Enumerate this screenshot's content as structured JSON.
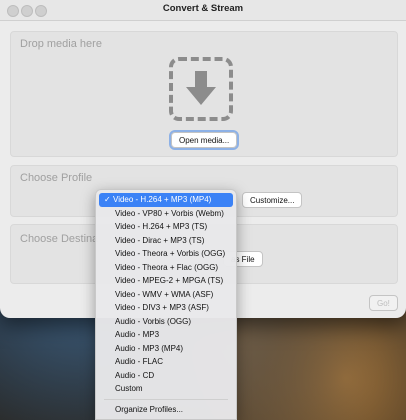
{
  "window": {
    "title": "Convert & Stream"
  },
  "drop": {
    "label": "Drop media here",
    "open_button": "Open media..."
  },
  "profile": {
    "label": "Choose Profile",
    "customize_button": "Customize...",
    "menu": {
      "selected_check": "✓",
      "items": [
        "Video - H.264 + MP3 (MP4)",
        "Video - VP80 + Vorbis (Webm)",
        "Video - H.264 + MP3 (TS)",
        "Video - Dirac + MP3 (TS)",
        "Video - Theora + Vorbis (OGG)",
        "Video - Theora + Flac (OGG)",
        "Video - MPEG-2 + MPGA (TS)",
        "Video - WMV + WMA (ASF)",
        "Video - DIV3 + MP3 (ASF)",
        "Audio - Vorbis (OGG)",
        "Audio - MP3",
        "Audio - MP3 (MP4)",
        "Audio - FLAC",
        "Audio - CD",
        "Custom"
      ],
      "organize": "Organize Profiles..."
    }
  },
  "destination": {
    "label": "Choose Destina",
    "save_file_button": "as File"
  },
  "go_button": "Go!"
}
